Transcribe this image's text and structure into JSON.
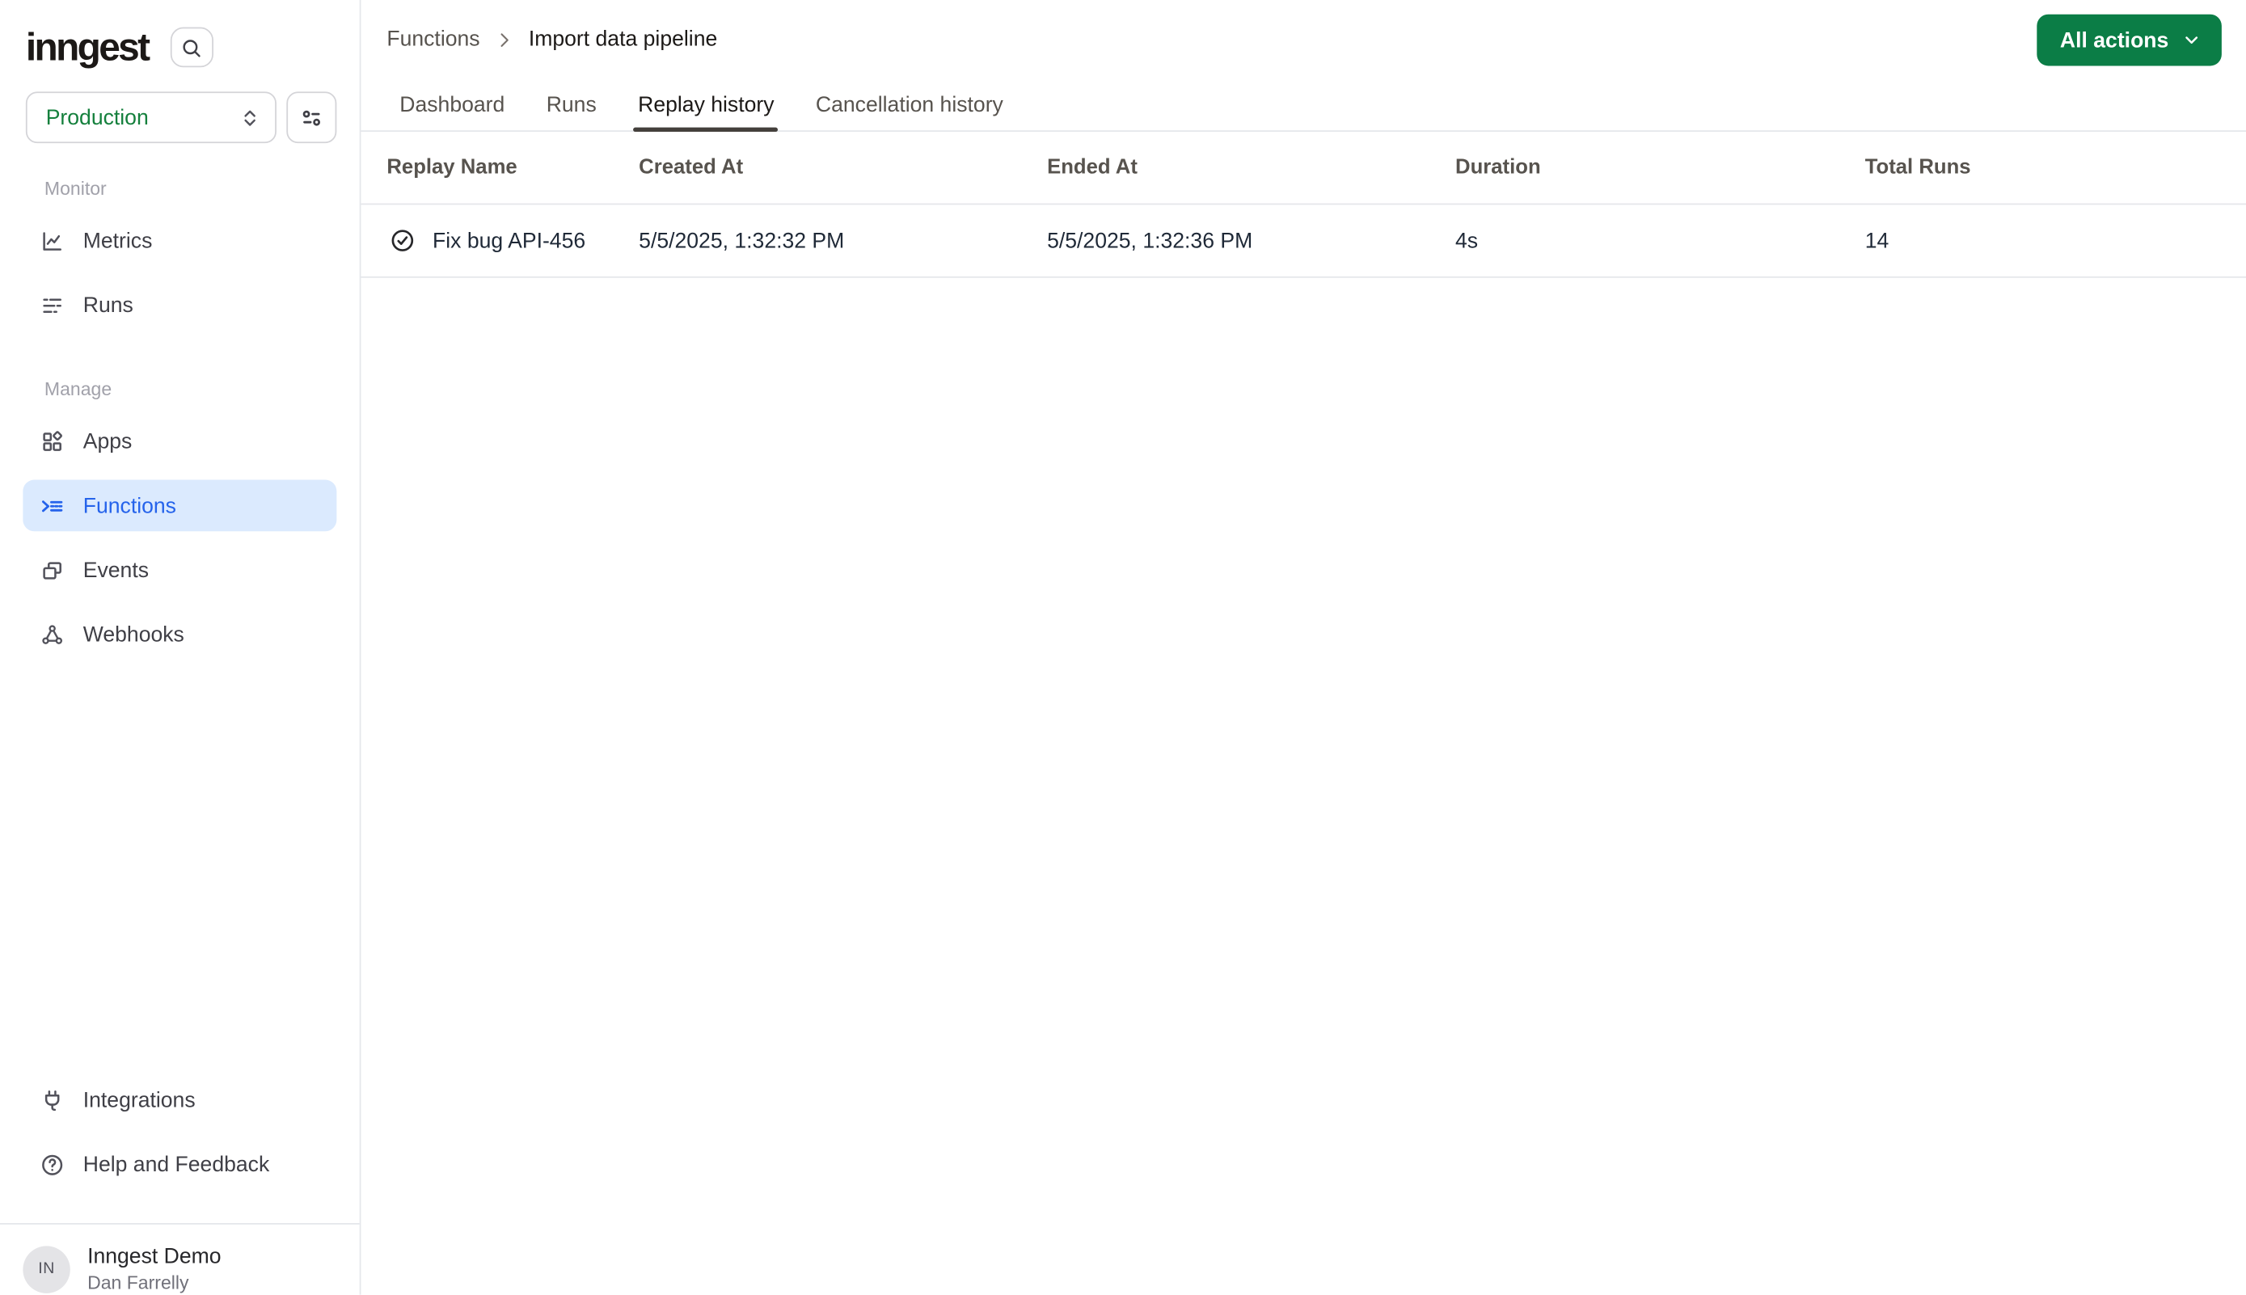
{
  "colors": {
    "brand_green_button": "#0b7d46",
    "production_env_green": "#15803d",
    "active_nav_blue": "#2563eb",
    "active_nav_blue_bg": "#dbeafe"
  },
  "sidebar": {
    "logo_text": "inngest",
    "env_selector": {
      "value": "Production"
    },
    "sections": [
      {
        "label": "Monitor",
        "items": [
          {
            "label": "Metrics"
          },
          {
            "label": "Runs"
          }
        ]
      },
      {
        "label": "Manage",
        "items": [
          {
            "label": "Apps"
          },
          {
            "label": "Functions"
          },
          {
            "label": "Events"
          },
          {
            "label": "Webhooks"
          }
        ]
      }
    ],
    "footer_items": [
      {
        "label": "Integrations"
      },
      {
        "label": "Help and Feedback"
      }
    ],
    "user": {
      "initials": "IN",
      "org_name": "Inngest Demo",
      "user_name": "Dan Farrelly"
    }
  },
  "header": {
    "breadcrumb": {
      "parent": "Functions",
      "current": "Import data pipeline"
    },
    "all_actions_label": "All actions"
  },
  "tabs": [
    {
      "label": "Dashboard"
    },
    {
      "label": "Runs"
    },
    {
      "label": "Replay history"
    },
    {
      "label": "Cancellation history"
    }
  ],
  "table": {
    "columns": [
      "Replay Name",
      "Created At",
      "Ended At",
      "Duration",
      "Total Runs"
    ],
    "rows": [
      {
        "name": "Fix bug API-456",
        "created_at": "5/5/2025, 1:32:32 PM",
        "ended_at": "5/5/2025, 1:32:36 PM",
        "duration": "4s",
        "total_runs": "14"
      }
    ]
  }
}
